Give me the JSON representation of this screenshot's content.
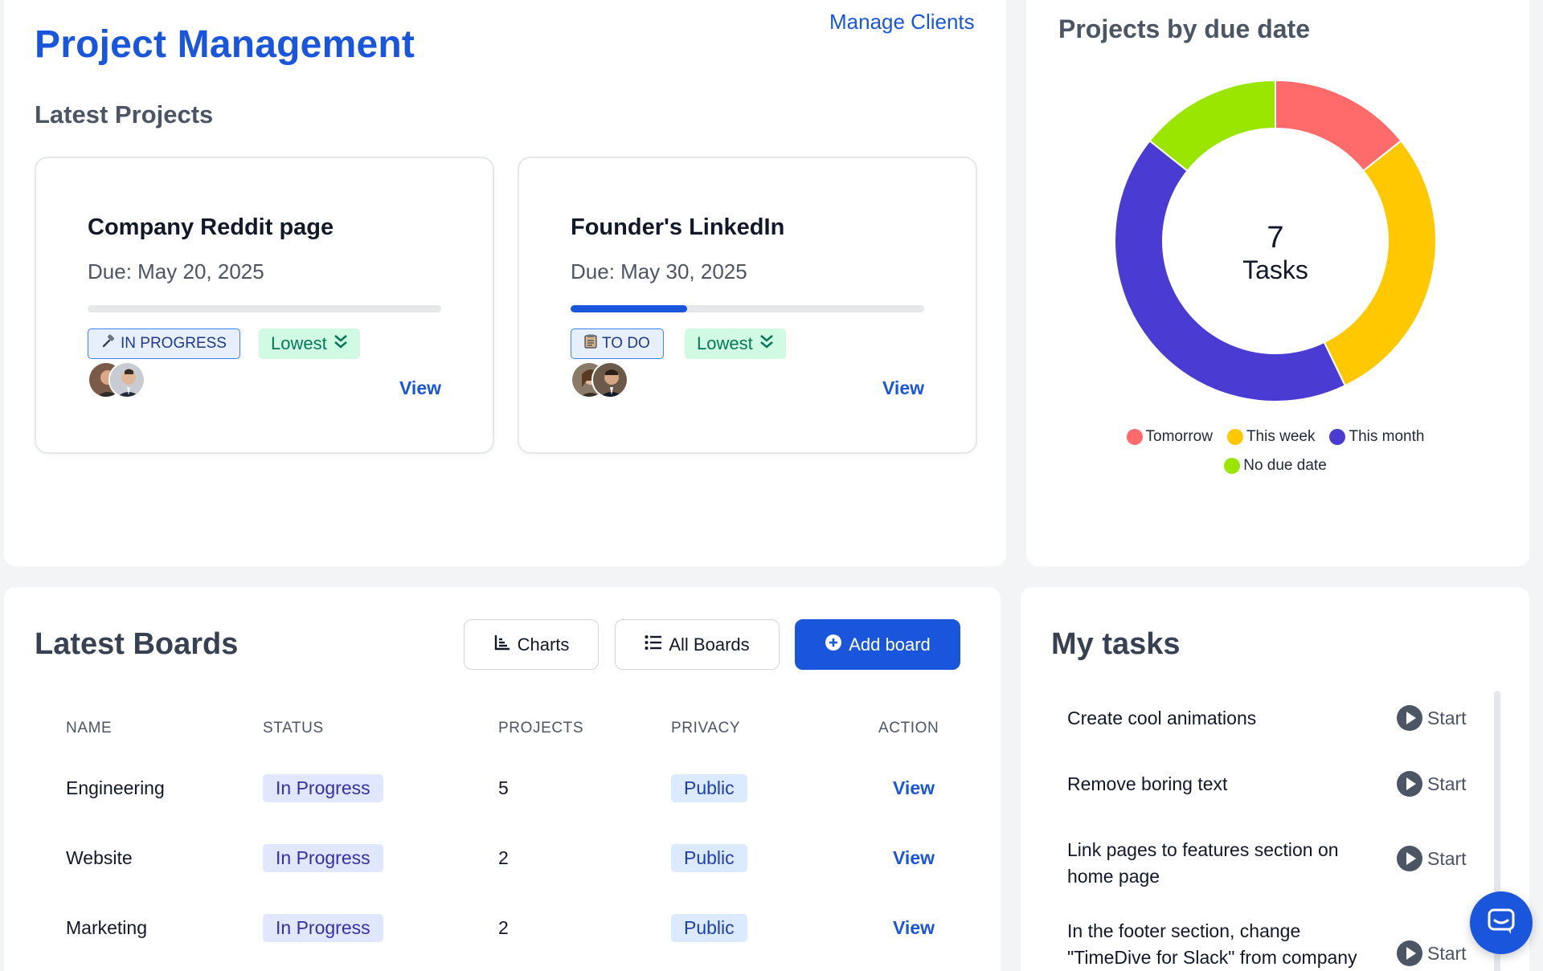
{
  "header": {
    "title": "Project Management",
    "manage_clients": "Manage Clients",
    "latest_projects": "Latest Projects"
  },
  "projects": [
    {
      "title": "Company Reddit page",
      "due": "Due: May 20, 2025",
      "progress": 0,
      "status": "IN PROGRESS",
      "status_icon": "hammer-icon",
      "priority": "Lowest",
      "view": "View"
    },
    {
      "title": "Founder's LinkedIn",
      "due": "Due: May 30, 2025",
      "progress": 0.33,
      "status": "TO DO",
      "status_icon": "clipboard-icon",
      "priority": "Lowest",
      "view": "View"
    }
  ],
  "chart_panel": {
    "title": "Projects by due date"
  },
  "chart_data": {
    "type": "pie",
    "title": "Projects by due date",
    "center_value": "7",
    "center_label": "Tasks",
    "categories": [
      "Tomorrow",
      "This week",
      "This month",
      "No due date"
    ],
    "values": [
      1,
      2,
      3,
      1
    ],
    "colors": [
      "#ff6b6b",
      "#ffc800",
      "#4a3bd2",
      "#9ae600"
    ],
    "legend_placement": "bottom"
  },
  "boards": {
    "title": "Latest Boards",
    "charts_btn": "Charts",
    "all_boards_btn": "All Boards",
    "add_board_btn": "Add board",
    "columns": [
      "NAME",
      "STATUS",
      "PROJECTS",
      "PRIVACY",
      "ACTION"
    ],
    "rows": [
      {
        "name": "Engineering",
        "status": "In Progress",
        "projects": "5",
        "privacy": "Public",
        "action": "View"
      },
      {
        "name": "Website",
        "status": "In Progress",
        "projects": "2",
        "privacy": "Public",
        "action": "View"
      },
      {
        "name": "Marketing",
        "status": "In Progress",
        "projects": "2",
        "privacy": "Public",
        "action": "View"
      }
    ]
  },
  "tasks": {
    "title": "My tasks",
    "items": [
      {
        "name": "Create cool animations",
        "action": "Start"
      },
      {
        "name": "Remove boring text",
        "action": "Start"
      },
      {
        "name": "Link pages to features section on home page",
        "action": "Start"
      },
      {
        "name": "In the footer section, change \"TimeDive for Slack\" from company",
        "action": "Start"
      }
    ]
  },
  "colors": {
    "accent": "#1a56db"
  }
}
